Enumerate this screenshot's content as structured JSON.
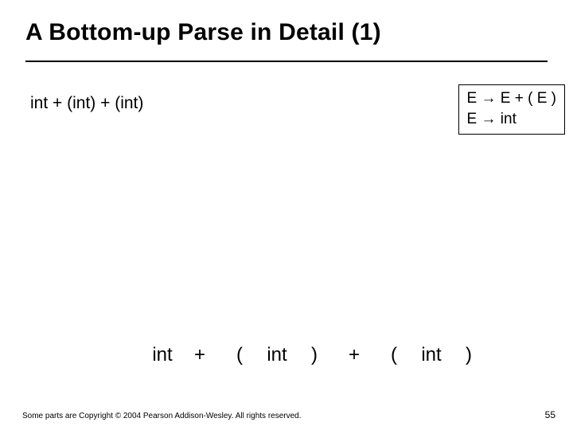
{
  "title": "A Bottom-up Parse in Detail (1)",
  "input_string": "int + (int) + (int)",
  "grammar": {
    "rule1_lhs": "E",
    "rule1_arrow": "→",
    "rule1_rhs": "E + ( E )",
    "rule2_lhs": "E",
    "rule2_arrow": "→",
    "rule2_rhs": "int"
  },
  "tokens": [
    "int",
    "+",
    "(",
    "int",
    ")",
    "+",
    "(",
    "int",
    ")"
  ],
  "footer": "Some parts are Copyright © 2004 Pearson Addison-Wesley. All rights reserved.",
  "page_number": "55"
}
